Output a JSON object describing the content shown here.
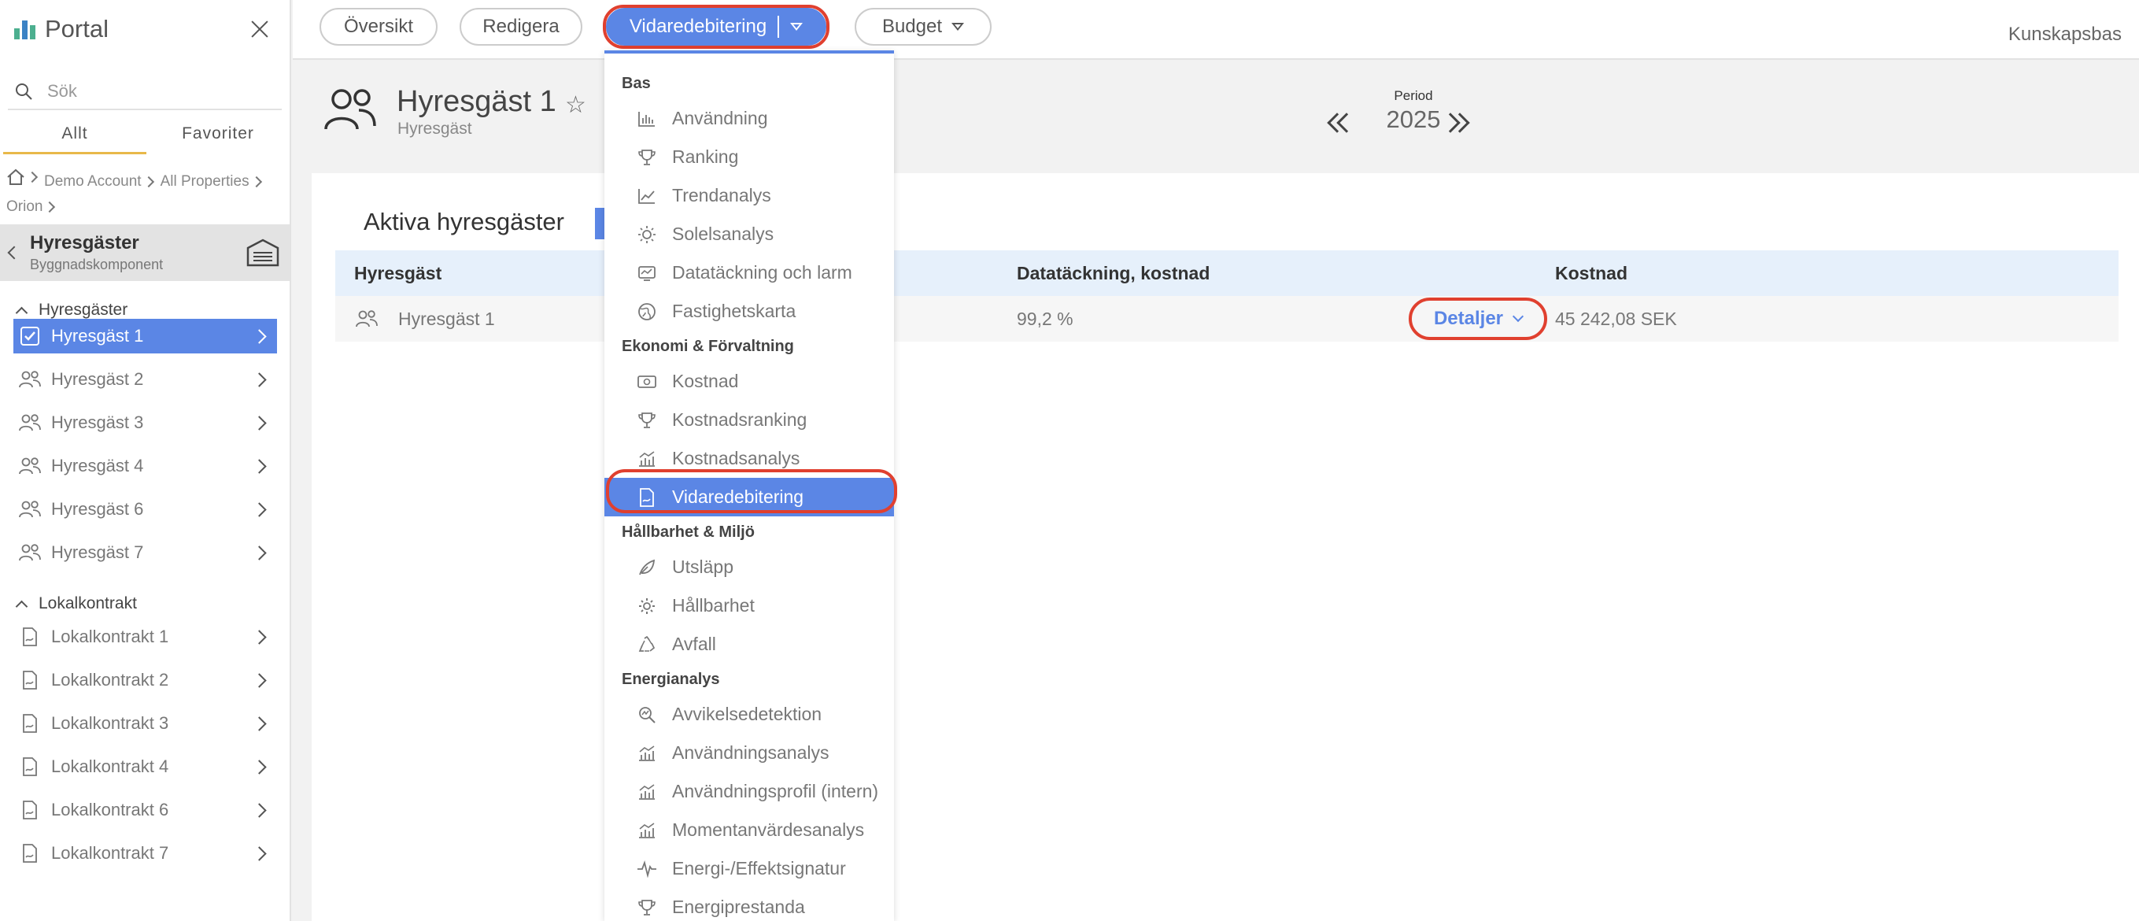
{
  "sidebar": {
    "app_title": "Portal",
    "search_placeholder": "Sök",
    "tabs": [
      "Allt",
      "Favoriter"
    ],
    "breadcrumb": [
      "Demo Account",
      "All Properties",
      "Orion"
    ],
    "context": {
      "title": "Hyresgäster",
      "subtitle": "Byggnadskomponent"
    },
    "sections": [
      {
        "title": "Hyresgäster",
        "items": [
          "Hyresgäst 1",
          "Hyresgäst 2",
          "Hyresgäst 3",
          "Hyresgäst 4",
          "Hyresgäst 6",
          "Hyresgäst 7"
        ]
      },
      {
        "title": "Lokalkontrakt",
        "items": [
          "Lokalkontrakt 1",
          "Lokalkontrakt 2",
          "Lokalkontrakt 3",
          "Lokalkontrakt 4",
          "Lokalkontrakt 6",
          "Lokalkontrakt 7"
        ]
      }
    ]
  },
  "topbar": {
    "tabs": [
      "Översikt",
      "Redigera",
      "Vidaredebitering",
      "Budget"
    ],
    "active_tab": "Vidaredebitering",
    "knowledge_link": "Kunskapsbas"
  },
  "header": {
    "title": "Hyresgäst 1",
    "subtitle": "Hyresgäst",
    "period_label": "Period",
    "period_year": "2025"
  },
  "table": {
    "title": "Aktiva hyresgäster",
    "columns": [
      "Hyresgäst",
      "Datatäckning, kostnad",
      "Kostnad"
    ],
    "rows": [
      {
        "name": "Hyresgäst 1",
        "coverage": "99,2 %",
        "cost": "45 242,08 SEK",
        "action": "Detaljer"
      }
    ]
  },
  "dropdown": {
    "groups": [
      {
        "title": "Bas",
        "items": [
          "Användning",
          "Ranking",
          "Trendanalys",
          "Solelsanalys",
          "Datatäckning och larm",
          "Fastighetskarta"
        ]
      },
      {
        "title": "Ekonomi & Förvaltning",
        "items": [
          "Kostnad",
          "Kostnadsranking",
          "Kostnadsanalys",
          "Vidaredebitering"
        ]
      },
      {
        "title": "Hållbarhet & Miljö",
        "items": [
          "Utsläpp",
          "Hållbarhet",
          "Avfall"
        ]
      },
      {
        "title": "Energianalys",
        "items": [
          "Avvikelsedetektion",
          "Användningsanalys",
          "Användningsprofil (intern)",
          "Momentanvärdesanalys",
          "Energi-/Effektsignatur",
          "Energiprestanda"
        ]
      }
    ],
    "active_item": "Vidaredebitering"
  },
  "colors": {
    "accent": "#5b86e5",
    "highlight_ring": "#e0402f",
    "table_header_bg": "#e6f0fb"
  }
}
